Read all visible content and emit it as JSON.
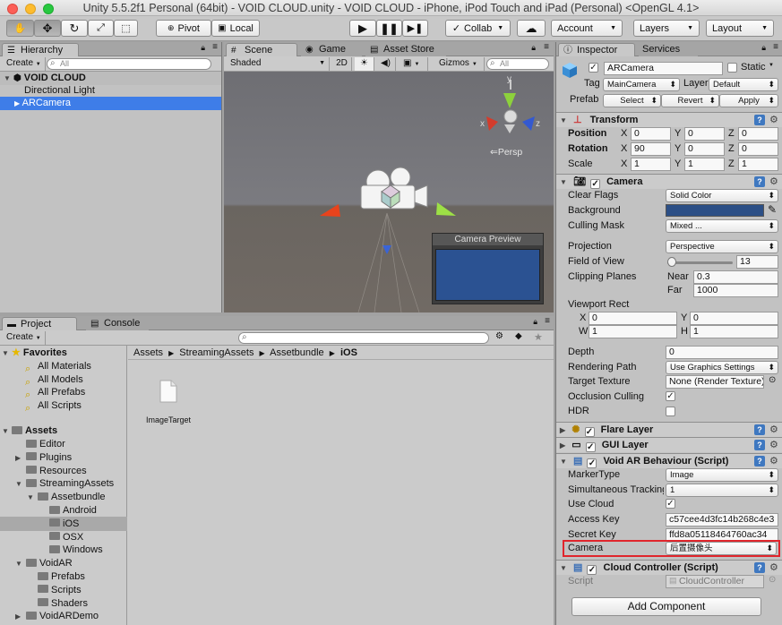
{
  "window": {
    "title": "Unity 5.5.2f1 Personal (64bit) - VOID CLOUD.unity - VOID CLOUD - iPhone, iPod Touch and iPad (Personal) <OpenGL 4.1>"
  },
  "toolbar": {
    "pivot": "Pivot",
    "local": "Local",
    "collab": "Collab",
    "account": "Account",
    "layers": "Layers",
    "layout": "Layout"
  },
  "hierarchy": {
    "tab": "Hierarchy",
    "create": "Create",
    "search_placeholder": "All",
    "scene_name": "VOID CLOUD",
    "items": [
      "Directional Light",
      "ARCamera"
    ]
  },
  "scene": {
    "tabs": [
      "Scene",
      "Game",
      "Asset Store"
    ],
    "shading": "Shaded",
    "mode2d": "2D",
    "gizmos": "Gizmos",
    "search_placeholder": "All",
    "persp": "Persp",
    "preview_title": "Camera Preview",
    "axis_x": "x",
    "axis_y": "y",
    "axis_z": "z"
  },
  "project": {
    "tabs": [
      "Project",
      "Console"
    ],
    "create": "Create",
    "favorites_label": "Favorites",
    "favorites": [
      "All Materials",
      "All Models",
      "All Prefabs",
      "All Scripts"
    ],
    "assets_label": "Assets",
    "tree": [
      {
        "label": "Editor",
        "depth": 1,
        "expander": ""
      },
      {
        "label": "Plugins",
        "depth": 1,
        "expander": "▶"
      },
      {
        "label": "Resources",
        "depth": 1,
        "expander": ""
      },
      {
        "label": "StreamingAssets",
        "depth": 1,
        "expander": "▼"
      },
      {
        "label": "Assetbundle",
        "depth": 2,
        "expander": "▼"
      },
      {
        "label": "Android",
        "depth": 3,
        "expander": ""
      },
      {
        "label": "iOS",
        "depth": 3,
        "expander": "",
        "selected": true
      },
      {
        "label": "OSX",
        "depth": 3,
        "expander": ""
      },
      {
        "label": "Windows",
        "depth": 3,
        "expander": ""
      },
      {
        "label": "VoidAR",
        "depth": 1,
        "expander": "▼"
      },
      {
        "label": "Prefabs",
        "depth": 2,
        "expander": ""
      },
      {
        "label": "Scripts",
        "depth": 2,
        "expander": ""
      },
      {
        "label": "Shaders",
        "depth": 2,
        "expander": ""
      },
      {
        "label": "VoidARDemo",
        "depth": 1,
        "expander": "▶"
      }
    ],
    "breadcrumb": [
      "Assets",
      "StreamingAssets",
      "Assetbundle",
      "iOS"
    ],
    "file_name": "ImageTarget"
  },
  "inspector": {
    "tabs": [
      "Inspector",
      "Services"
    ],
    "object_name": "ARCamera",
    "static_label": "Static",
    "tag_label": "Tag",
    "tag_value": "MainCamera",
    "layer_label": "Layer",
    "layer_value": "Default",
    "prefab_label": "Prefab",
    "prefab_select": "Select",
    "prefab_revert": "Revert",
    "prefab_apply": "Apply",
    "transform": {
      "title": "Transform",
      "position_label": "Position",
      "rotation_label": "Rotation",
      "scale_label": "Scale",
      "x": "X",
      "y": "Y",
      "z": "Z",
      "position": [
        "0",
        "0",
        "0"
      ],
      "rotation": [
        "90",
        "0",
        "0"
      ],
      "scale": [
        "1",
        "1",
        "1"
      ]
    },
    "camera": {
      "title": "Camera",
      "clear_flags_label": "Clear Flags",
      "clear_flags": "Solid Color",
      "background_label": "Background",
      "background_color": "#2c4f86",
      "culling_mask_label": "Culling Mask",
      "culling_mask": "Mixed ...",
      "projection_label": "Projection",
      "projection": "Perspective",
      "fov_label": "Field of View",
      "fov": "13",
      "fov_fraction": 0.07,
      "clipping_label": "Clipping Planes",
      "near_label": "Near",
      "near": "0.3",
      "far_label": "Far",
      "far": "1000",
      "viewport_label": "Viewport Rect",
      "vx_label": "X",
      "vx": "0",
      "vy_label": "Y",
      "vy": "0",
      "vw_label": "W",
      "vw": "1",
      "vh_label": "H",
      "vh": "1",
      "depth_label": "Depth",
      "depth": "0",
      "rendering_path_label": "Rendering Path",
      "rendering_path": "Use Graphics Settings",
      "target_texture_label": "Target Texture",
      "target_texture": "None (Render Texture)",
      "occlusion_label": "Occlusion Culling",
      "hdr_label": "HDR"
    },
    "flare_layer": "Flare Layer",
    "gui_layer": "GUI Layer",
    "void_ar": {
      "title": "Void AR Behaviour (Script)",
      "marker_type_label": "MarkerType",
      "marker_type": "Image",
      "simultaneous_label": "Simultaneous Tracking",
      "simultaneous": "1",
      "use_cloud_label": "Use Cloud",
      "access_key_label": "Access Key",
      "access_key": "c57cee4d3fc14b268c4e3",
      "secret_key_label": "Secret Key",
      "secret_key": "ffd8a05118464760ac34",
      "camera_label": "Camera",
      "camera_value": "后置摄像头"
    },
    "cloud_controller": {
      "title": "Cloud Controller (Script)",
      "script_label": "Script",
      "script_value": "CloudController"
    },
    "add_component": "Add Component"
  }
}
